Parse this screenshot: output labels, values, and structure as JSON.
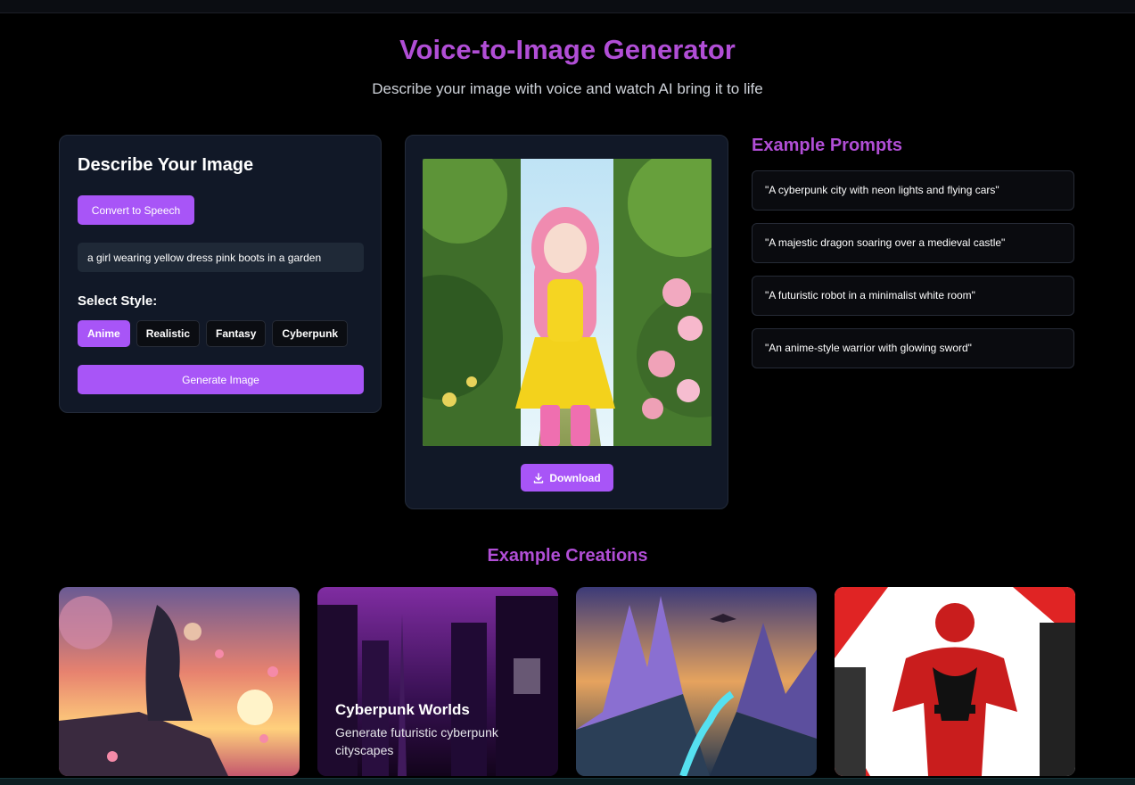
{
  "page": {
    "title": "Voice-to-Image Generator",
    "subtitle": "Describe your image with voice and watch AI bring it to life"
  },
  "describe_panel": {
    "heading": "Describe Your Image",
    "convert_button": "Convert to Speech",
    "prompt_text": "a girl wearing yellow dress pink boots in a garden",
    "style_label": "Select Style:",
    "styles": [
      "Anime",
      "Realistic",
      "Fantasy",
      "Cyberpunk"
    ],
    "selected_style": "Anime",
    "generate_button": "Generate Image"
  },
  "result_panel": {
    "download_button": "Download",
    "download_icon": "download-icon"
  },
  "example_prompts": {
    "title": "Example Prompts",
    "items": [
      "\"A cyberpunk city with neon lights and flying cars\"",
      "\"A majestic dragon soaring over a medieval castle\"",
      "\"A futuristic robot in a minimalist white room\"",
      "\"An anime-style warrior with glowing sword\""
    ]
  },
  "example_creations": {
    "title": "Example Creations",
    "cards": [
      {
        "title": "",
        "description": ""
      },
      {
        "title": "Cyberpunk Worlds",
        "description": "Generate futuristic cyberpunk cityscapes"
      },
      {
        "title": "",
        "description": ""
      },
      {
        "title": "",
        "description": ""
      }
    ]
  },
  "colors": {
    "accent": "#a855f7",
    "heading": "#b14ed6",
    "panel": "#111827",
    "background": "#000000"
  }
}
